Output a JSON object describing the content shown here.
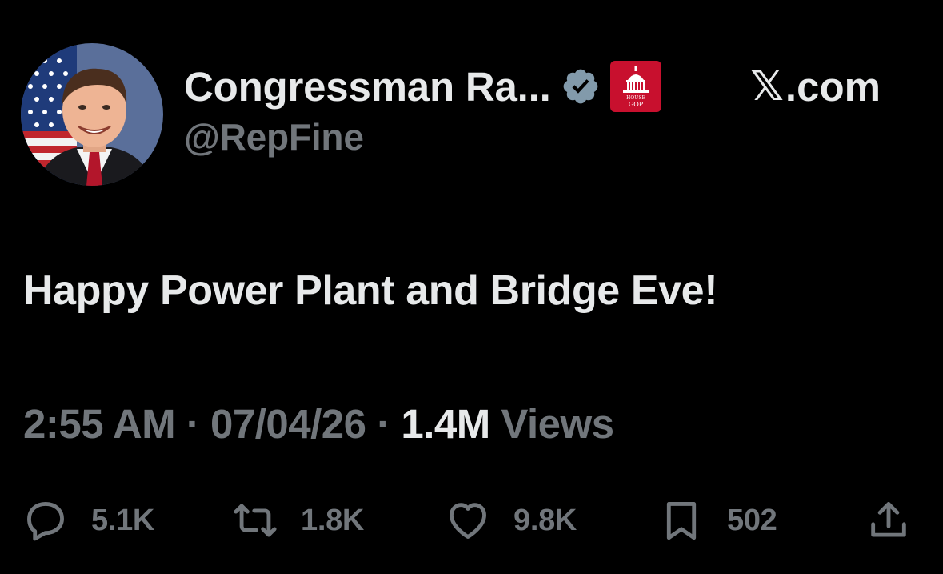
{
  "author": {
    "display_name": "Congressman Ra...",
    "handle": "@RepFine",
    "verified_icon": "verified-badge-icon",
    "affiliation_badge": "house-gop-badge",
    "affiliation_badge_text": "HOUSE GOP",
    "affiliation_color": "#c8102e"
  },
  "source": {
    "logo": "𝕏",
    "label": ".com"
  },
  "tweet": {
    "text": "Happy Power Plant and Bridge Eve!"
  },
  "meta": {
    "time": "2:55 AM",
    "sep1": " · ",
    "date": "07/04/26",
    "sep2": " · ",
    "views_count": "1.4M",
    "views_label": " Views"
  },
  "actions": {
    "reply_count": "5.1K",
    "repost_count": "1.8K",
    "like_count": "9.8K",
    "bookmark_count": "502"
  },
  "colors": {
    "background": "#000000",
    "primary_text": "#e7e9ea",
    "secondary_text": "#71767b"
  }
}
